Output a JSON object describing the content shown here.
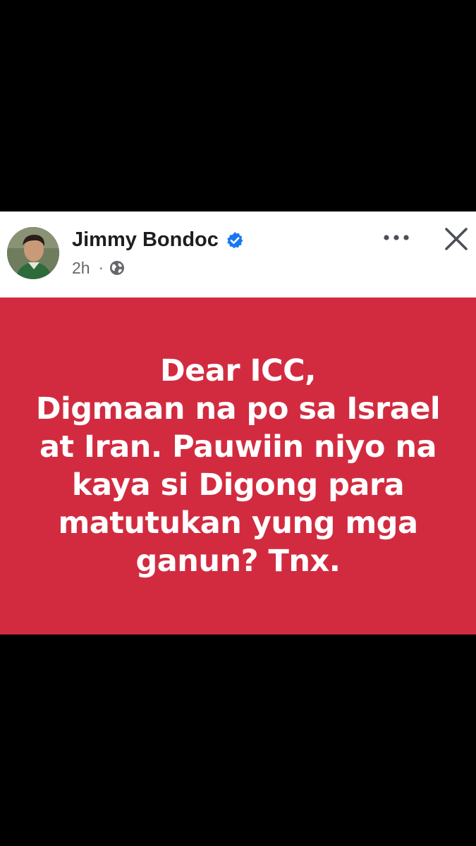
{
  "post": {
    "author": {
      "name": "Jimmy Bondoc",
      "verified": true,
      "avatar_icon": "profile-photo"
    },
    "meta": {
      "time": "2h",
      "separator": "·",
      "privacy_icon": "globe-icon"
    },
    "actions": {
      "more_icon": "more-options-icon",
      "close_icon": "close-icon"
    },
    "content": {
      "background_color": "#d22b40",
      "text_color": "#ffffff",
      "lines": [
        "Dear ICC,",
        "Digmaan na po sa Israel",
        "at Iran. Pauwiin niyo na",
        "kaya si Digong para",
        "matutukan yung mga",
        "ganun? Tnx."
      ]
    }
  },
  "colors": {
    "verified_badge": "#1877f2",
    "page_background": "#000000"
  }
}
